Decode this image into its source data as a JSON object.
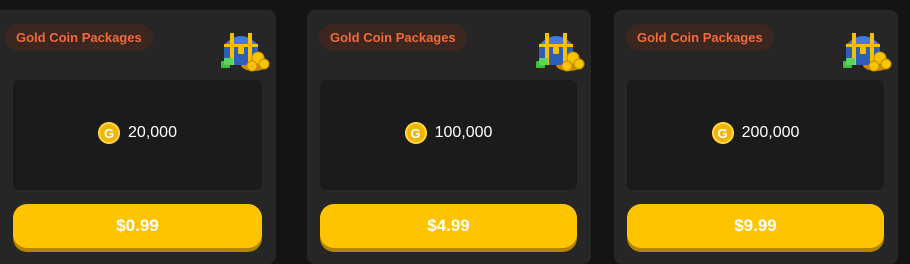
{
  "packages": [
    {
      "badge": "Gold Coin Packages",
      "icon": "treasure-chest-icon",
      "coin_icon": "gold-coin-icon",
      "coin_letter": "G",
      "amount": "20,000",
      "price": "$0.99"
    },
    {
      "badge": "Gold Coin Packages",
      "icon": "treasure-chest-icon",
      "coin_icon": "gold-coin-icon",
      "coin_letter": "G",
      "amount": "100,000",
      "price": "$4.99"
    },
    {
      "badge": "Gold Coin Packages",
      "icon": "treasure-chest-icon",
      "coin_icon": "gold-coin-icon",
      "coin_letter": "G",
      "amount": "200,000",
      "price": "$9.99"
    }
  ],
  "colors": {
    "background": "#141414",
    "card": "#262626",
    "amount_box": "#1b1b1b",
    "badge_bg": "#3b2620",
    "badge_text": "#f06a3a",
    "button": "#ffc400",
    "coin": "#f2b600"
  }
}
